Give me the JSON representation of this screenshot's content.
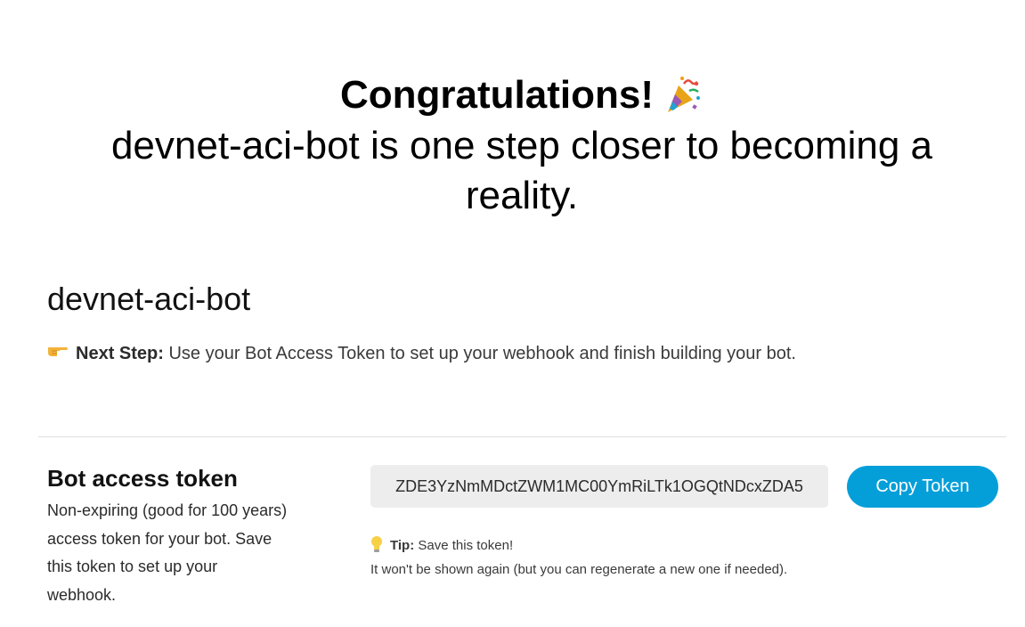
{
  "hero": {
    "title": "Congratulations!",
    "subtitle": "devnet-aci-bot is one step closer to becoming a reality."
  },
  "bot": {
    "name": "devnet-aci-bot"
  },
  "next_step": {
    "label": "Next Step:",
    "text": "Use your Bot Access Token to set up your webhook and finish building your bot."
  },
  "token": {
    "heading": "Bot access token",
    "description": "Non-expiring (good for 100 years) access token for your bot. Save this token to set up your webhook.",
    "value": "ZDE3YzNmMDctZWM1MC00YmRiLTk1OGQtNDcxZDA5",
    "copy_label": "Copy Token"
  },
  "tip": {
    "label": "Tip:",
    "text": "Save this token!",
    "detail": "It won't be shown again (but you can regenerate a new one if needed)."
  },
  "colors": {
    "accent": "#049fd9",
    "field_bg": "#ededed",
    "divider": "#dedede"
  },
  "icons": {
    "hero": "party-popper-icon",
    "next_step": "pointing-hand-icon",
    "tip": "light-bulb-icon"
  }
}
